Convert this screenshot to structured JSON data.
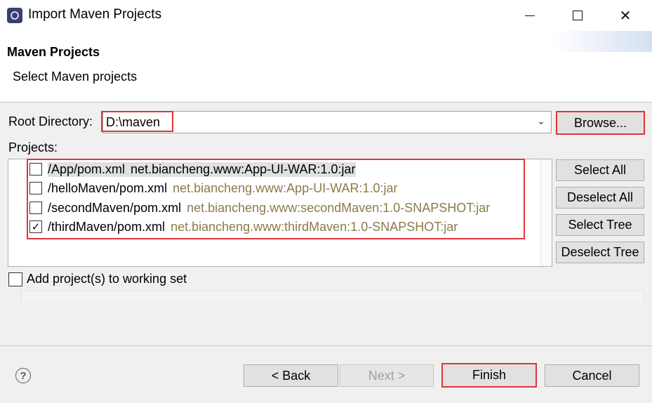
{
  "window": {
    "title": "Import Maven Projects",
    "icon": "eclipse-icon",
    "minimize_glyph": "",
    "close_glyph": "✕"
  },
  "header": {
    "title": "Maven Projects",
    "description": "Select Maven projects"
  },
  "root_directory": {
    "label": "Root Directory:",
    "value": "D:\\maven",
    "browse_label": "Browse..."
  },
  "projects": {
    "label": "Projects:",
    "items": [
      {
        "path": "/App/pom.xml",
        "artifact": "net.biancheng.www:App-UI-WAR:1.0:jar",
        "checked": false,
        "selected": true
      },
      {
        "path": "/helloMaven/pom.xml",
        "artifact": "net.biancheng.www:App-UI-WAR:1.0:jar",
        "checked": false,
        "selected": false
      },
      {
        "path": "/secondMaven/pom.xml",
        "artifact": "net.biancheng.www:secondMaven:1.0-SNAPSHOT:jar",
        "checked": false,
        "selected": false
      },
      {
        "path": "/thirdMaven/pom.xml",
        "artifact": "net.biancheng.www:thirdMaven:1.0-SNAPSHOT:jar",
        "checked": true,
        "selected": false
      }
    ],
    "check_glyph": "✓"
  },
  "side_buttons": {
    "select_all": "Select All",
    "deselect_all": "Deselect All",
    "select_tree": "Select Tree",
    "deselect_tree": "Deselect Tree"
  },
  "working_set": {
    "label": "Add project(s) to working set",
    "checked": false
  },
  "footer": {
    "help_glyph": "?",
    "back": "< Back",
    "next": "Next >",
    "finish": "Finish",
    "cancel": "Cancel"
  },
  "colors": {
    "highlight": "#e0343a",
    "artifact_text": "#8b7b4b"
  }
}
